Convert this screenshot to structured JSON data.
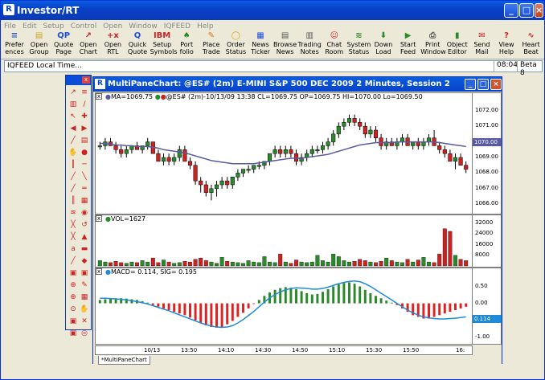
{
  "app": {
    "title": "Investor/RT"
  },
  "menu": [
    "File",
    "Edit",
    "Setup",
    "Control",
    "Open",
    "Window",
    "IQFEED",
    "Help"
  ],
  "toolbar": [
    {
      "label": "Prefer\nences",
      "icon": "preferences-icon",
      "glyph": "≡",
      "color": "#2a5bd7"
    },
    {
      "label": "Open\nGroup",
      "icon": "folder-open-icon",
      "glyph": "▤",
      "color": "#c9a227"
    },
    {
      "label": "Quote\nPage",
      "icon": "quote-page-icon",
      "glyph": "QP",
      "color": "#1e4fd8"
    },
    {
      "label": "Open\nChart",
      "icon": "chart-icon",
      "glyph": "↗",
      "color": "#c22"
    },
    {
      "label": "Open\nRTL",
      "icon": "rtl-icon",
      "glyph": "+x",
      "color": "#c22"
    },
    {
      "label": "Quick\nQuote",
      "icon": "quick-quote-icon",
      "glyph": "Q",
      "color": "#1e4fd8"
    },
    {
      "label": "Setup\nSymbols",
      "icon": "symbols-icon",
      "glyph": "IBM",
      "color": "#c22"
    },
    {
      "label": "Port\nfolio",
      "icon": "portfolio-icon",
      "glyph": "♠",
      "color": "#2a8a2a"
    },
    {
      "label": "Place\nTrade",
      "icon": "trade-icon",
      "glyph": "✎",
      "color": "#c97a10"
    },
    {
      "label": "Order\nStatus",
      "icon": "lightbulb-icon",
      "glyph": "◯",
      "color": "#d9a400"
    },
    {
      "label": "News\nTicker",
      "icon": "news-ticker-icon",
      "glyph": "▦",
      "color": "#1e4fd8"
    },
    {
      "label": "Browse\nNews",
      "icon": "browse-news-icon",
      "glyph": "▤",
      "color": "#555"
    },
    {
      "label": "Trading\nNotes",
      "icon": "notes-icon",
      "glyph": "▥",
      "color": "#555"
    },
    {
      "label": "Chat\nRoom",
      "icon": "chat-icon",
      "glyph": "☺",
      "color": "#c22"
    },
    {
      "label": "System\nStatus",
      "icon": "system-status-icon",
      "glyph": "≋",
      "color": "#2a8a2a"
    },
    {
      "label": "Down\nLoad",
      "icon": "download-icon",
      "glyph": "⬇",
      "color": "#2a8a2a"
    },
    {
      "label": "Start\nFeed",
      "icon": "play-icon",
      "glyph": "▶",
      "color": "#2a8a2a"
    },
    {
      "label": "Print\nWindow",
      "icon": "print-icon",
      "glyph": "⎙",
      "color": "#555"
    },
    {
      "label": "Object\nEditor",
      "icon": "object-editor-icon",
      "glyph": "▮",
      "color": "#2a8a2a"
    },
    {
      "label": "Send\nMail",
      "icon": "mail-icon",
      "glyph": "✉",
      "color": "#c22"
    },
    {
      "label": "View\nHelp",
      "icon": "help-icon",
      "glyph": "?",
      "color": "#c22"
    },
    {
      "label": "Heart\nBeat",
      "icon": "heartbeat-icon",
      "glyph": "∿",
      "color": "#c22"
    }
  ],
  "status": {
    "text": "IQFEED Local Time...",
    "time": "08:04",
    "version": "Beta 8"
  },
  "chartwin": {
    "title": "MultiPaneChart: @ES# (2m) E-MINI S&P 500 DEC 2009 2 Minutes, Session 2",
    "tab": "*MultiPaneChart"
  },
  "price_pane": {
    "header_ma": "MA=1069.75",
    "header_bars": "@ES# (2m)-10/13/09 13:38 CL=1069.75 OP=1069.75 HI=1070.00 Lo=1069.50",
    "ticks": [
      "1072.00",
      "1071.00",
      "1070.00",
      "1069.00",
      "1068.00",
      "1067.00",
      "1066.00"
    ],
    "current": "1070.00"
  },
  "vol_pane": {
    "header": "VOL=1627",
    "ticks": [
      "32000",
      "24000",
      "16000",
      "8000"
    ]
  },
  "macd_pane": {
    "header": "MACD= 0.114, SIG= 0.195",
    "ticks": [
      "0.50",
      "0.00",
      "-0.50",
      "-1.00"
    ],
    "current": "0.114"
  },
  "x_ticks": [
    "10/13",
    "13:50",
    "14:10",
    "14:30",
    "14:50",
    "15:10",
    "15:30",
    "15:50",
    "16:"
  ],
  "colors": {
    "up": "#2a8a2a",
    "down": "#c22",
    "ma": "#5a5aa0",
    "macd": "#1e8ad8",
    "signal": "#1e8ad8",
    "hist_up": "#2a8a2a",
    "hist_down": "#d22"
  },
  "chart_data": {
    "type": "candlestick+bar+line",
    "ohlc": [
      [
        1069.75,
        1070.0,
        1069.5,
        1069.75
      ],
      [
        1069.75,
        1070.25,
        1069.5,
        1070.0
      ],
      [
        1070.0,
        1070.25,
        1069.75,
        1069.75
      ],
      [
        1069.75,
        1070.0,
        1069.25,
        1069.5
      ],
      [
        1069.5,
        1069.75,
        1069.0,
        1069.25
      ],
      [
        1069.25,
        1069.75,
        1069.0,
        1069.5
      ],
      [
        1069.5,
        1069.75,
        1069.25,
        1069.75
      ],
      [
        1069.75,
        1070.0,
        1069.5,
        1069.5
      ],
      [
        1069.5,
        1069.75,
        1069.25,
        1069.75
      ],
      [
        1069.75,
        1070.25,
        1069.5,
        1070.0
      ],
      [
        1070.0,
        1070.0,
        1069.25,
        1069.25
      ],
      [
        1069.25,
        1069.5,
        1068.75,
        1068.75
      ],
      [
        1068.75,
        1069.25,
        1068.5,
        1069.0
      ],
      [
        1069.0,
        1069.25,
        1068.5,
        1068.75
      ],
      [
        1068.75,
        1069.25,
        1068.5,
        1069.0
      ],
      [
        1069.0,
        1069.75,
        1068.75,
        1069.5
      ],
      [
        1069.5,
        1069.75,
        1068.75,
        1068.75
      ],
      [
        1068.75,
        1069.0,
        1068.25,
        1068.5
      ],
      [
        1068.5,
        1068.75,
        1067.25,
        1067.5
      ],
      [
        1067.5,
        1067.75,
        1066.75,
        1067.25
      ],
      [
        1067.25,
        1067.5,
        1066.5,
        1066.75
      ],
      [
        1066.75,
        1067.25,
        1066.25,
        1067.0
      ],
      [
        1067.0,
        1067.5,
        1066.5,
        1067.25
      ],
      [
        1067.25,
        1067.75,
        1067.0,
        1067.5
      ],
      [
        1067.5,
        1067.75,
        1067.0,
        1067.25
      ],
      [
        1067.25,
        1067.75,
        1067.0,
        1067.75
      ],
      [
        1067.75,
        1068.25,
        1067.5,
        1068.0
      ],
      [
        1068.0,
        1068.25,
        1067.75,
        1068.25
      ],
      [
        1068.25,
        1068.5,
        1068.0,
        1068.25
      ],
      [
        1068.25,
        1068.5,
        1068.0,
        1068.5
      ],
      [
        1068.5,
        1068.75,
        1068.25,
        1068.5
      ],
      [
        1068.5,
        1068.75,
        1068.25,
        1068.75
      ],
      [
        1068.75,
        1069.25,
        1068.5,
        1069.25
      ],
      [
        1069.25,
        1069.75,
        1069.0,
        1069.5
      ],
      [
        1069.5,
        1069.75,
        1069.0,
        1069.25
      ],
      [
        1069.25,
        1069.75,
        1069.0,
        1069.5
      ],
      [
        1069.5,
        1069.75,
        1069.0,
        1069.25
      ],
      [
        1069.25,
        1069.5,
        1068.5,
        1068.75
      ],
      [
        1068.75,
        1069.25,
        1068.5,
        1069.0
      ],
      [
        1069.0,
        1069.5,
        1068.75,
        1069.25
      ],
      [
        1069.25,
        1069.75,
        1069.0,
        1069.5
      ],
      [
        1069.5,
        1069.75,
        1069.25,
        1069.5
      ],
      [
        1069.5,
        1070.0,
        1069.25,
        1069.75
      ],
      [
        1069.75,
        1070.25,
        1069.5,
        1070.0
      ],
      [
        1070.0,
        1070.75,
        1069.75,
        1070.5
      ],
      [
        1070.5,
        1071.25,
        1070.25,
        1071.0
      ],
      [
        1071.0,
        1071.5,
        1070.75,
        1071.25
      ],
      [
        1071.25,
        1071.75,
        1071.0,
        1071.5
      ],
      [
        1071.5,
        1071.75,
        1071.0,
        1071.25
      ],
      [
        1071.25,
        1071.5,
        1070.75,
        1071.0
      ],
      [
        1071.0,
        1071.25,
        1070.25,
        1070.5
      ],
      [
        1070.5,
        1071.0,
        1070.25,
        1070.75
      ],
      [
        1070.75,
        1071.0,
        1070.0,
        1070.25
      ],
      [
        1070.25,
        1070.5,
        1069.5,
        1069.75
      ],
      [
        1069.75,
        1070.25,
        1069.5,
        1070.0
      ],
      [
        1070.0,
        1070.25,
        1069.75,
        1069.75
      ],
      [
        1069.75,
        1070.25,
        1069.5,
        1070.0
      ],
      [
        1070.0,
        1070.5,
        1069.75,
        1070.25
      ],
      [
        1070.25,
        1070.5,
        1069.75,
        1069.75
      ],
      [
        1069.75,
        1070.0,
        1069.5,
        1070.0
      ],
      [
        1070.0,
        1070.25,
        1069.5,
        1069.75
      ],
      [
        1069.75,
        1070.25,
        1069.5,
        1070.0
      ],
      [
        1070.0,
        1070.5,
        1069.75,
        1070.25
      ],
      [
        1070.25,
        1070.75,
        1069.75,
        1069.75
      ],
      [
        1069.75,
        1070.0,
        1069.25,
        1069.5
      ],
      [
        1069.5,
        1069.75,
        1069.0,
        1069.25
      ],
      [
        1069.25,
        1069.5,
        1068.75,
        1068.75
      ],
      [
        1068.75,
        1069.25,
        1068.25,
        1069.0
      ],
      [
        1069.0,
        1069.25,
        1068.5,
        1068.5
      ],
      [
        1068.5,
        1068.75,
        1068.0,
        1068.25
      ]
    ],
    "ma": [
      1069.9,
      1069.9,
      1069.85,
      1069.8,
      1069.8,
      1069.75,
      1069.75,
      1069.7,
      1069.7,
      1069.7,
      1069.65,
      1069.6,
      1069.5,
      1069.45,
      1069.4,
      1069.35,
      1069.3,
      1069.2,
      1069.1,
      1069.0,
      1068.9,
      1068.8,
      1068.75,
      1068.7,
      1068.65,
      1068.6,
      1068.6,
      1068.6,
      1068.6,
      1068.6,
      1068.65,
      1068.7,
      1068.75,
      1068.8,
      1068.85,
      1068.9,
      1068.95,
      1068.95,
      1068.95,
      1069.0,
      1069.05,
      1069.1,
      1069.15,
      1069.2,
      1069.3,
      1069.4,
      1069.5,
      1069.6,
      1069.7,
      1069.8,
      1069.85,
      1069.9,
      1069.95,
      1069.95,
      1069.95,
      1069.95,
      1070.0,
      1070.0,
      1070.0,
      1070.0,
      1070.0,
      1070.0,
      1070.0,
      1070.0,
      1069.95,
      1069.9,
      1069.85,
      1069.8,
      1069.75,
      1069.7
    ],
    "volume": [
      4000,
      3000,
      2500,
      3500,
      2500,
      2000,
      3000,
      2500,
      4000,
      3000,
      6000,
      2500,
      4500,
      3000,
      2000,
      2500,
      3500,
      3000,
      5000,
      6000,
      4000,
      3000,
      2000,
      6500,
      3500,
      3000,
      2500,
      2000,
      4000,
      3000,
      2500,
      7000,
      3000,
      2500,
      9000,
      3000,
      2000,
      4500,
      3000,
      2500,
      3000,
      8000,
      4000,
      3000,
      9000,
      7000,
      4000,
      3000,
      3500,
      5000,
      4000,
      3000,
      2500,
      3500,
      6000,
      4000,
      3000,
      2500,
      5000,
      3000,
      4500,
      6500,
      3000,
      2500,
      9000,
      28000,
      26000,
      8000,
      5000,
      4000
    ],
    "macd_hist": [
      0.1,
      0.12,
      0.14,
      0.15,
      0.15,
      0.14,
      0.12,
      0.1,
      0.06,
      0.02,
      -0.05,
      -0.1,
      -0.15,
      -0.2,
      -0.25,
      -0.3,
      -0.35,
      -0.42,
      -0.5,
      -0.58,
      -0.65,
      -0.7,
      -0.72,
      -0.7,
      -0.62,
      -0.52,
      -0.4,
      -0.28,
      -0.15,
      -0.02,
      0.1,
      0.22,
      0.32,
      0.4,
      0.45,
      0.48,
      0.46,
      0.42,
      0.36,
      0.3,
      0.26,
      0.28,
      0.34,
      0.42,
      0.5,
      0.56,
      0.6,
      0.62,
      0.58,
      0.5,
      0.4,
      0.3,
      0.22,
      0.15,
      0.08,
      0.02,
      -0.05,
      -0.15,
      -0.25,
      -0.35,
      -0.4,
      -0.45,
      -0.45,
      -0.4,
      -0.35,
      -0.3,
      -0.25,
      -0.2,
      -0.15,
      -0.1
    ],
    "macd_line": [
      0.15,
      0.15,
      0.14,
      0.13,
      0.12,
      0.1,
      0.08,
      0.05,
      0.02,
      -0.02,
      -0.07,
      -0.12,
      -0.17,
      -0.22,
      -0.28,
      -0.34,
      -0.4,
      -0.46,
      -0.52,
      -0.58,
      -0.63,
      -0.67,
      -0.7,
      -0.71,
      -0.7,
      -0.66,
      -0.58,
      -0.48,
      -0.36,
      -0.24,
      -0.1,
      0.04,
      0.16,
      0.26,
      0.34,
      0.4,
      0.44,
      0.46,
      0.45,
      0.44,
      0.42,
      0.42,
      0.44,
      0.48,
      0.53,
      0.58,
      0.62,
      0.65,
      0.66,
      0.64,
      0.58,
      0.5,
      0.4,
      0.3,
      0.2,
      0.1,
      0.0,
      -0.1,
      -0.2,
      -0.28,
      -0.35,
      -0.4,
      -0.43,
      -0.45,
      -0.46,
      -0.46,
      -0.45,
      -0.44,
      -0.42,
      -0.4
    ],
    "xlabel": "",
    "ylabel": ""
  }
}
